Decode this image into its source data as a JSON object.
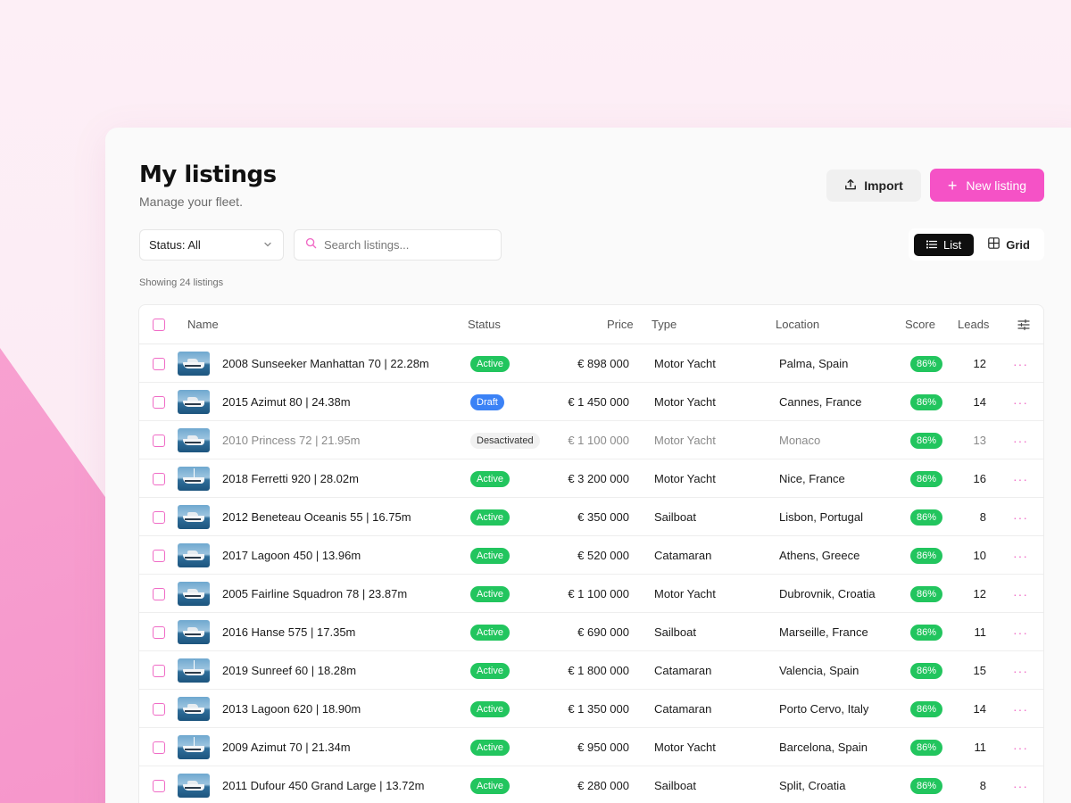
{
  "header": {
    "title": "My listings",
    "subtitle": "Manage your fleet.",
    "import_label": "Import",
    "new_listing_label": "New listing",
    "accent": "#f552c6"
  },
  "filters": {
    "status_label": "Status: All",
    "search_placeholder": "Search listings...",
    "view_list_label": "List",
    "view_grid_label": "Grid",
    "active_view": "List"
  },
  "summary": {
    "showing": "Showing 24 listings"
  },
  "table": {
    "columns": {
      "name": "Name",
      "status": "Status",
      "price": "Price",
      "type": "Type",
      "location": "Location",
      "score": "Score",
      "leads": "Leads"
    },
    "rows": [
      {
        "name": "2008 Sunseeker Manhattan 70 | 22.28m",
        "status": "Active",
        "price": "€ 898 000",
        "type": "Motor Yacht",
        "location": "Palma, Spain",
        "score": "86%",
        "leads": "12",
        "thumb": "motor"
      },
      {
        "name": "2015 Azimut 80 | 24.38m",
        "status": "Draft",
        "price": "€ 1 450 000",
        "type": "Motor Yacht",
        "location": "Cannes, France",
        "score": "86%",
        "leads": "14",
        "thumb": "motor"
      },
      {
        "name": "2010 Princess 72 | 21.95m",
        "status": "Desactivated",
        "price": "€ 1 100 000",
        "type": "Motor Yacht",
        "location": "Monaco",
        "score": "86%",
        "leads": "13",
        "thumb": "motor"
      },
      {
        "name": "2018 Ferretti 920 | 28.02m",
        "status": "Active",
        "price": "€ 3 200 000",
        "type": "Motor Yacht",
        "location": "Nice, France",
        "score": "86%",
        "leads": "16",
        "thumb": "sail"
      },
      {
        "name": "2012 Beneteau Oceanis 55 | 16.75m",
        "status": "Active",
        "price": "€ 350 000",
        "type": "Sailboat",
        "location": "Lisbon, Portugal",
        "score": "86%",
        "leads": "8",
        "thumb": "motor"
      },
      {
        "name": "2017 Lagoon 450 | 13.96m",
        "status": "Active",
        "price": "€ 520 000",
        "type": "Catamaran",
        "location": "Athens, Greece",
        "score": "86%",
        "leads": "10",
        "thumb": "motor"
      },
      {
        "name": "2005 Fairline Squadron 78 | 23.87m",
        "status": "Active",
        "price": "€ 1 100 000",
        "type": "Motor Yacht",
        "location": "Dubrovnik, Croatia",
        "score": "86%",
        "leads": "12",
        "thumb": "motor"
      },
      {
        "name": "2016 Hanse 575 | 17.35m",
        "status": "Active",
        "price": "€ 690 000",
        "type": "Sailboat",
        "location": "Marseille, France",
        "score": "86%",
        "leads": "11",
        "thumb": "motor"
      },
      {
        "name": "2019 Sunreef 60 | 18.28m",
        "status": "Active",
        "price": "€ 1 800 000",
        "type": "Catamaran",
        "location": "Valencia, Spain",
        "score": "86%",
        "leads": "15",
        "thumb": "sail"
      },
      {
        "name": "2013 Lagoon 620 | 18.90m",
        "status": "Active",
        "price": "€ 1 350 000",
        "type": "Catamaran",
        "location": "Porto Cervo, Italy",
        "score": "86%",
        "leads": "14",
        "thumb": "motor"
      },
      {
        "name": "2009 Azimut 70 | 21.34m",
        "status": "Active",
        "price": "€ 950 000",
        "type": "Motor Yacht",
        "location": "Barcelona, Spain",
        "score": "86%",
        "leads": "11",
        "thumb": "sail"
      },
      {
        "name": "2011 Dufour 450 Grand Large | 13.72m",
        "status": "Active",
        "price": "€ 280 000",
        "type": "Sailboat",
        "location": "Split, Croatia",
        "score": "86%",
        "leads": "8",
        "thumb": "motor"
      }
    ]
  },
  "status_colors": {
    "Active": "#22c55e",
    "Draft": "#3b82f6",
    "Desactivated": "#f1f1f1"
  },
  "icons": {
    "import": "upload-icon",
    "new": "plus-icon",
    "dropdown": "chevron-down-icon",
    "search": "search-icon",
    "list": "list-icon",
    "grid": "grid-icon",
    "columns": "sliders-icon",
    "row_menu": "more-horizontal-icon"
  }
}
